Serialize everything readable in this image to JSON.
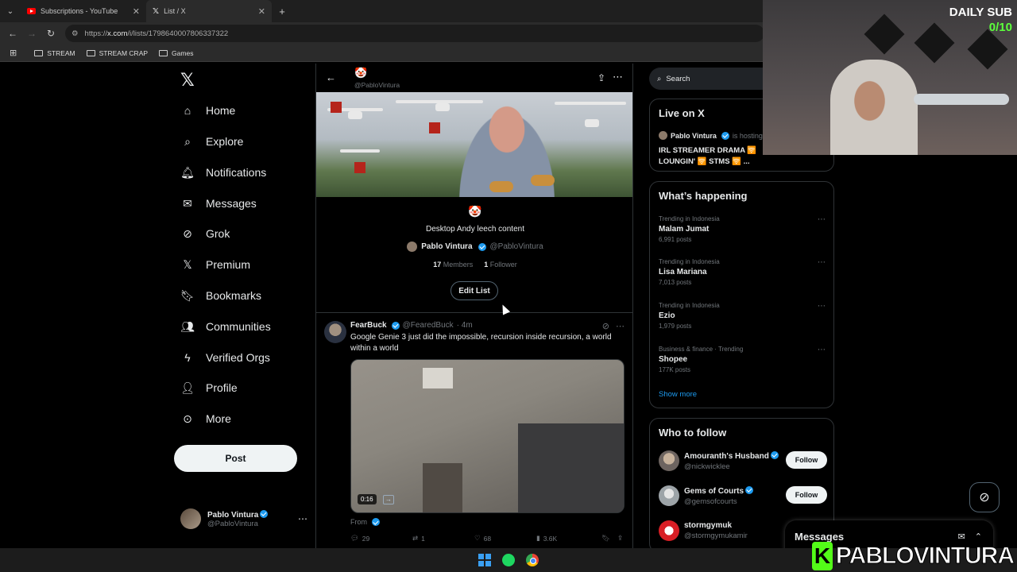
{
  "browser": {
    "tabs": [
      {
        "title": "Subscriptions - YouTube",
        "favicon": "youtube-icon"
      },
      {
        "title": "List / X",
        "favicon": "x-icon"
      }
    ],
    "url_prefix": "https://",
    "url_host": "x.com",
    "url_path": "/i/lists/1798640007806337322",
    "bookmarks": [
      "STREAM",
      "STREAM CRAP",
      "Games"
    ]
  },
  "nav": {
    "items": [
      "Home",
      "Explore",
      "Notifications",
      "Messages",
      "Grok",
      "Premium",
      "Bookmarks",
      "Communities",
      "Verified Orgs",
      "Profile",
      "More"
    ],
    "post_label": "Post",
    "me": {
      "name": "Pablo Vintura",
      "handle": "@PabloVintura"
    }
  },
  "list": {
    "header_emoji": "🤡",
    "header_handle": "@PabloVintura",
    "emoji": "🤡",
    "name": "Desktop Andy leech content",
    "owner_name": "Pablo Vintura",
    "owner_handle": "@PabloVintura",
    "members_count": "17",
    "members_label": "Members",
    "followers_count": "1",
    "followers_label": "Follower",
    "edit_label": "Edit List"
  },
  "tweet": {
    "name": "FearBuck",
    "handle": "@FearedBuck",
    "time": "· 4m",
    "text": "Google Genie 3 just did the impossible, recursion inside recursion, a world within a world",
    "duration": "0:16",
    "from_label": "From",
    "replies": "29",
    "reposts": "1",
    "likes": "68",
    "views": "3.6K"
  },
  "right": {
    "search_placeholder": "Search",
    "live": {
      "title": "Live on X",
      "host_name": "Pablo Vintura",
      "host_suffix": "is hosting",
      "text": "IRL STREAMER DRAMA 🛜 LOUNGIN' 🛜 STMS 🛜 ..."
    },
    "happening": {
      "title": "What’s happening",
      "trends": [
        {
          "context": "Trending in Indonesia",
          "name": "Malam Jumat",
          "count": "6,991 posts"
        },
        {
          "context": "Trending in Indonesia",
          "name": "Lisa Mariana",
          "count": "7,013 posts"
        },
        {
          "context": "Trending in Indonesia",
          "name": "Ezio",
          "count": "1,979 posts"
        },
        {
          "context": "Business & finance · Trending",
          "name": "Shopee",
          "count": "177K posts"
        }
      ],
      "show_more": "Show more"
    },
    "who_to_follow": {
      "title": "Who to follow",
      "accounts": [
        {
          "name": "Amouranth's Husband",
          "handle": "@nickwicklee",
          "button": "Follow"
        },
        {
          "name": "Gems of Courts",
          "handle": "@gemsofcourts",
          "button": "Follow"
        },
        {
          "name": "stormgymuk",
          "handle": "@stormgymukamir",
          "button": ""
        }
      ]
    }
  },
  "messages_drawer": {
    "title": "Messages"
  },
  "overlay": {
    "daily_sub_label": "DAILY SUB",
    "daily_sub_count": "0/10",
    "brand_letter": "K",
    "brand_name": "PABLOVINTURA"
  },
  "colors": {
    "accent": "#1d9bf0",
    "brand": "#53fc18",
    "background": "#000000"
  }
}
